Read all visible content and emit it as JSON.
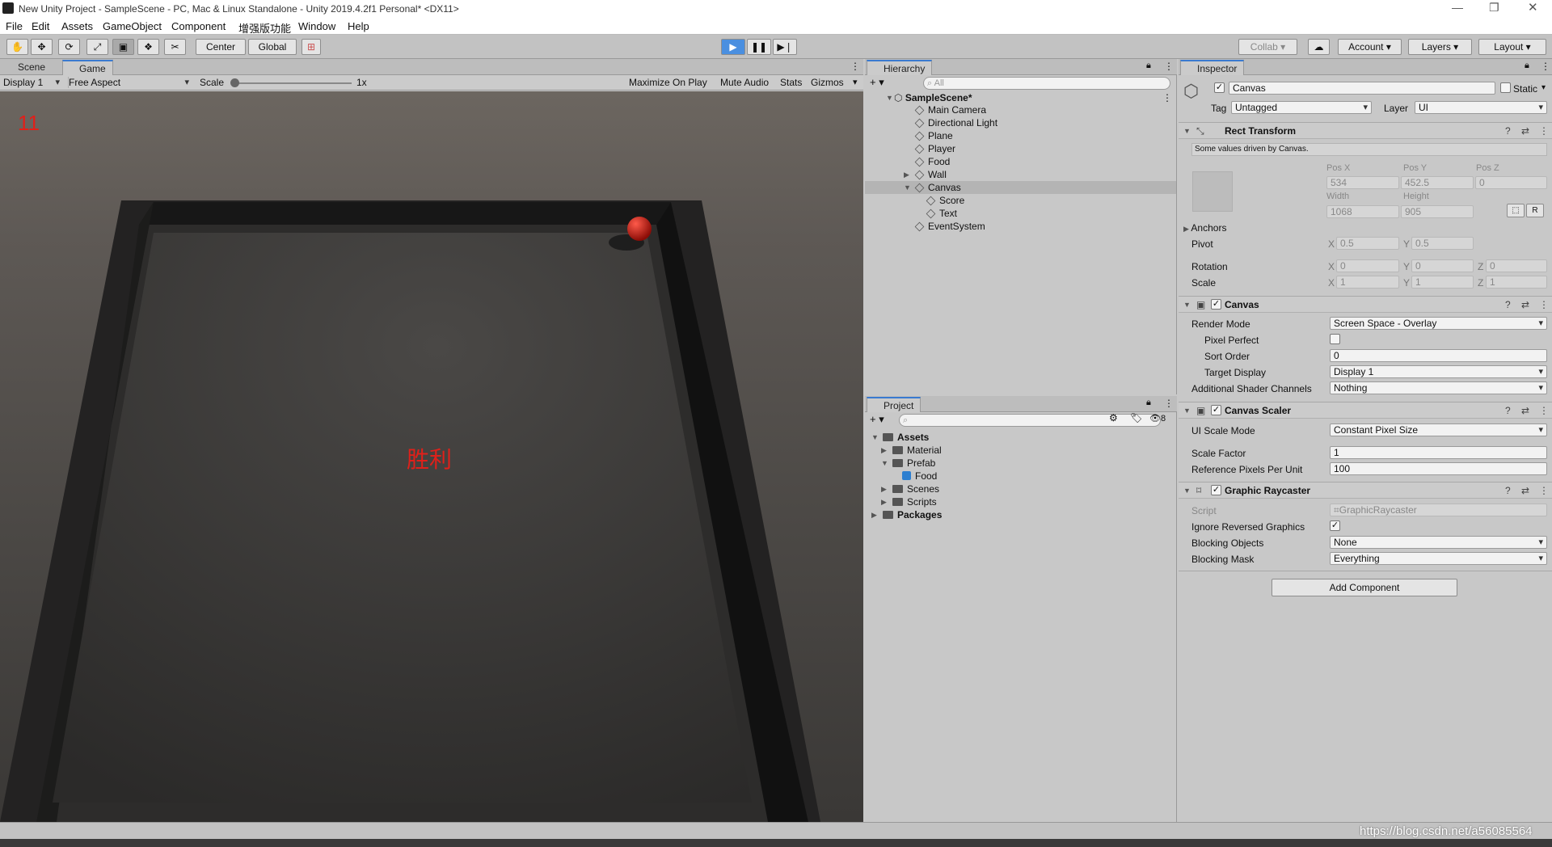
{
  "window": {
    "title": "New Unity Project - SampleScene - PC, Mac & Linux Standalone - Unity 2019.4.2f1 Personal* <DX11>",
    "icon": "unity-logo-icon"
  },
  "menu": [
    "File",
    "Edit",
    "Assets",
    "GameObject",
    "Component",
    "增强版功能",
    "Window",
    "Help"
  ],
  "toolbar": {
    "pivot": "Center",
    "space": "Global",
    "collab": "Collab",
    "account": "Account",
    "layers": "Layers",
    "layout": "Layout"
  },
  "scene_tabs": [
    "Scene",
    "Game"
  ],
  "game_bar": {
    "display": "Display 1",
    "aspect": "Free Aspect",
    "scale_label": "Scale",
    "scale_value": "1x",
    "maximize": "Maximize On Play",
    "mute": "Mute Audio",
    "stats": "Stats",
    "gizmos": "Gizmos"
  },
  "game_view": {
    "score": "11",
    "win_text": "胜利",
    "text_color": "#e0201a"
  },
  "hierarchy": {
    "tab": "Hierarchy",
    "search_placeholder": "All",
    "scene": "SampleScene*",
    "items": [
      "Main Camera",
      "Directional Light",
      "Plane",
      "Player",
      "Food",
      "Wall",
      "Canvas",
      "Score",
      "Text",
      "EventSystem"
    ]
  },
  "project": {
    "tab": "Project",
    "hidden_count": "8",
    "items": [
      "Assets",
      "Material",
      "Prefab",
      "Food",
      "Scenes",
      "Scripts",
      "Packages"
    ]
  },
  "inspector": {
    "tab": "Inspector",
    "object_name": "Canvas",
    "static": "Static",
    "tag_label": "Tag",
    "tag": "Untagged",
    "layer_label": "Layer",
    "layer": "UI",
    "rect": {
      "title": "Rect Transform",
      "note": "Some values driven by Canvas.",
      "posx_label": "Pos X",
      "posy_label": "Pos Y",
      "posz_label": "Pos Z",
      "posx": "534",
      "posy": "452.5",
      "posz": "0",
      "width_label": "Width",
      "height_label": "Height",
      "width": "1068",
      "height": "905",
      "anchors": "Anchors",
      "pivot": "Pivot",
      "pivot_x": "0.5",
      "pivot_y": "0.5",
      "rotation": "Rotation",
      "rot_x": "0",
      "rot_y": "0",
      "rot_z": "0",
      "scale": "Scale",
      "scale_x": "1",
      "scale_y": "1",
      "scale_z": "1",
      "x": "X",
      "y": "Y",
      "z": "Z",
      "r": "R"
    },
    "canvas": {
      "title": "Canvas",
      "render_mode_label": "Render Mode",
      "render_mode": "Screen Space - Overlay",
      "pixel_perfect": "Pixel Perfect",
      "sort_order_label": "Sort Order",
      "sort_order": "0",
      "target_display_label": "Target Display",
      "target_display": "Display 1",
      "shader_channels_label": "Additional Shader Channels",
      "shader_channels": "Nothing"
    },
    "scaler": {
      "title": "Canvas Scaler",
      "mode_label": "UI Scale Mode",
      "mode": "Constant Pixel Size",
      "factor_label": "Scale Factor",
      "factor": "1",
      "ppu_label": "Reference Pixels Per Unit",
      "ppu": "100"
    },
    "raycaster": {
      "title": "Graphic Raycaster",
      "script_label": "Script",
      "script": "GraphicRaycaster",
      "ignore_label": "Ignore Reversed Graphics",
      "blocking_objects_label": "Blocking Objects",
      "blocking_objects": "None",
      "blocking_mask_label": "Blocking Mask",
      "blocking_mask": "Everything"
    },
    "add_component": "Add Component"
  },
  "watermark": "https://blog.csdn.net/a56085564"
}
